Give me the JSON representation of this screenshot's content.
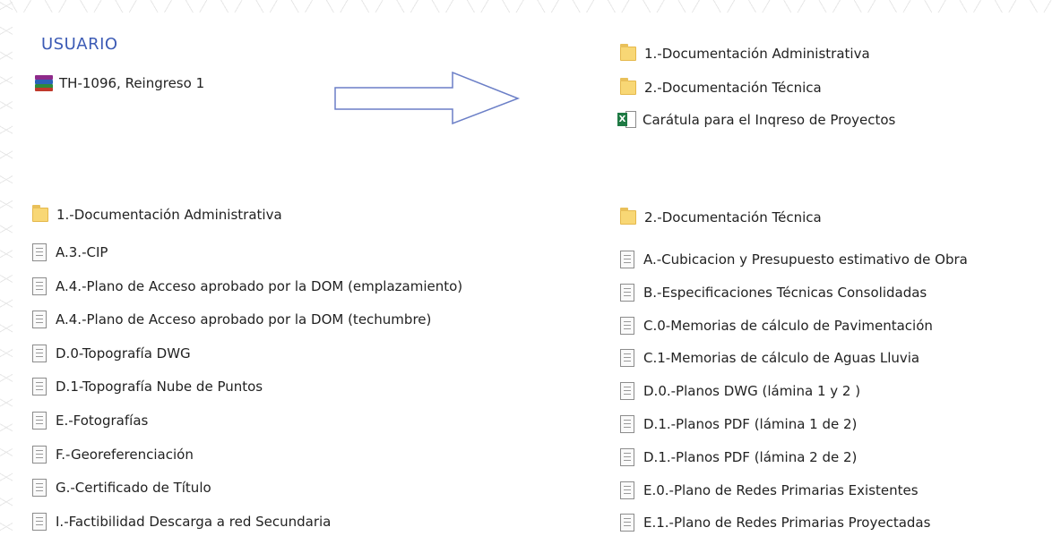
{
  "user": {
    "title": "USUARIO",
    "file": {
      "label": "TH-1096, Reingreso 1",
      "icon": "winrar-archive-icon"
    }
  },
  "result_items": [
    {
      "label": "1.-Documentación Administrativa",
      "icon": "folder-icon"
    },
    {
      "label": "2.-Documentación Técnica",
      "icon": "folder-icon"
    },
    {
      "label": "Carátula para el Inqreso de Proyectos",
      "icon": "excel-file-icon"
    }
  ],
  "admin": {
    "folder": "1.-Documentación Administrativa",
    "files": [
      "A.3.-CIP",
      "A.4.-Plano de Acceso aprobado por la DOM (emplazamiento)",
      "A.4.-Plano de Acceso aprobado por la DOM (techumbre)",
      "D.0-Topografía DWG",
      "D.1-Topografía Nube de Puntos",
      "E.-Fotografías",
      "F.-Georeferenciación",
      "G.-Certificado de Título",
      "I.-Factibilidad Descarga a red Secundaria"
    ]
  },
  "tech": {
    "folder": "2.-Documentación Técnica",
    "files": [
      "A.-Cubicacion y Presupuesto estimativo de Obra",
      "B.-Especificaciones Técnicas Consolidadas",
      "C.0-Memorias de cálculo de Pavimentación",
      "C.1-Memorias de cálculo de Aguas Lluvia",
      "D.0.-Planos DWG (lámina 1 y 2 )",
      "D.1.-Planos PDF (lámina 1 de 2)",
      "D.1.-Planos PDF (lámina 2 de 2)",
      "E.0.-Plano de Redes Primarias Existentes",
      "E.1.-Plano de Redes Primarias Proyectadas"
    ]
  },
  "colors": {
    "accent": "#3c5bb5",
    "arrow": "#6b7fc7",
    "folder": "#f8d775",
    "excel": "#1f7a44"
  }
}
